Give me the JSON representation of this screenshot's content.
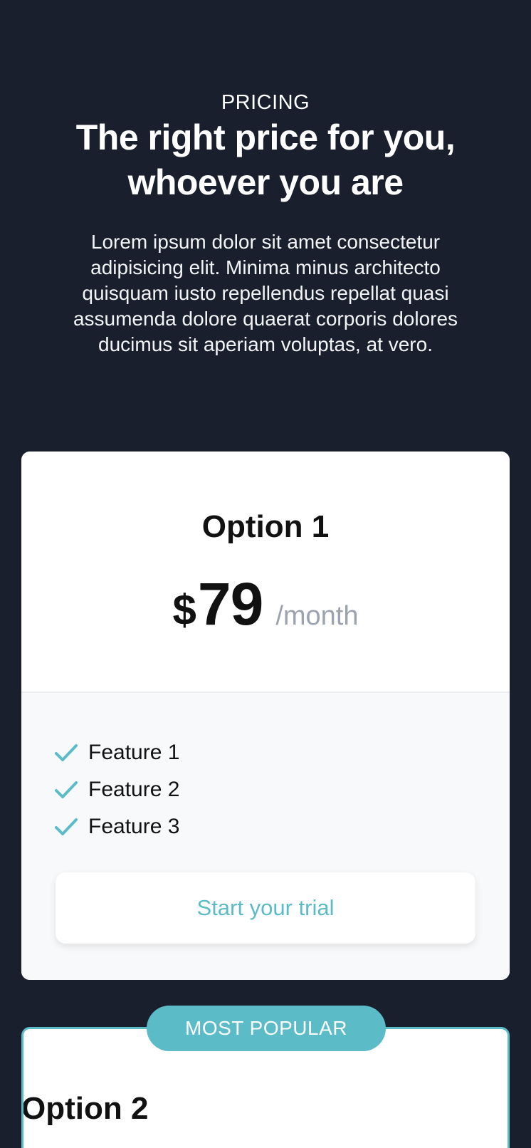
{
  "hero": {
    "eyebrow": "PRICING",
    "headline": "The right price for you, whoever you are",
    "lead": "Lorem ipsum dolor sit amet consectetur adipisicing elit. Minima minus architecto quisquam iusto repellendus repellat quasi assumenda dolore quaerat corporis dolores ducimus sit aperiam voluptas, at vero."
  },
  "plans": [
    {
      "name": "Option 1",
      "currency": "$",
      "price": "79",
      "period": "/month",
      "features": [
        "Feature 1",
        "Feature 2",
        "Feature 3"
      ],
      "cta_label": "Start your trial"
    },
    {
      "badge": "MOST POPULAR",
      "name": "Option 2"
    }
  ],
  "colors": {
    "background": "#1a1f2e",
    "accent": "#5bbcc8",
    "muted": "#9ca3af"
  },
  "icons": {
    "feature_check": "check-icon"
  }
}
